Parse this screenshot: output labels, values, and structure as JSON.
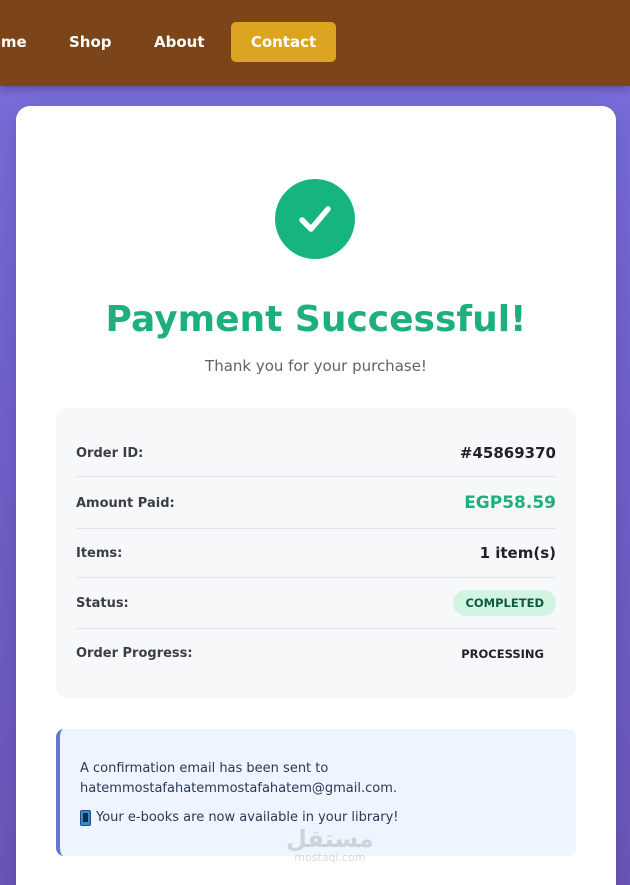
{
  "nav": {
    "home": "Home",
    "shop": "Shop",
    "about": "About",
    "contact": "Contact"
  },
  "colors": {
    "navbar": "#7b4519",
    "contact_button": "#dba521",
    "success": "#1db07a",
    "badge_bg": "#d2f5e3",
    "info_border": "#6876d2"
  },
  "hero": {
    "icon": "check-icon",
    "title": "Payment Successful!",
    "subtitle": "Thank you for your purchase!"
  },
  "order": {
    "rows": [
      {
        "label": "Order ID:",
        "value": "#45869370"
      },
      {
        "label": "Amount Paid:",
        "value": "EGP58.59"
      },
      {
        "label": "Items:",
        "value": "1 item(s)"
      },
      {
        "label": "Status:",
        "value": "COMPLETED"
      },
      {
        "label": "Order Progress:",
        "value": "PROCESSING"
      }
    ]
  },
  "info": {
    "line1": "A confirmation email has been sent to",
    "email": "hatemmostafahatemmostafahatem@gmail.com.",
    "library": "Your e-books are now available in your library!",
    "library_icon": "mobile-phone-icon"
  },
  "watermark": {
    "arabic": "مستقل",
    "latin": "mostaql.com"
  }
}
